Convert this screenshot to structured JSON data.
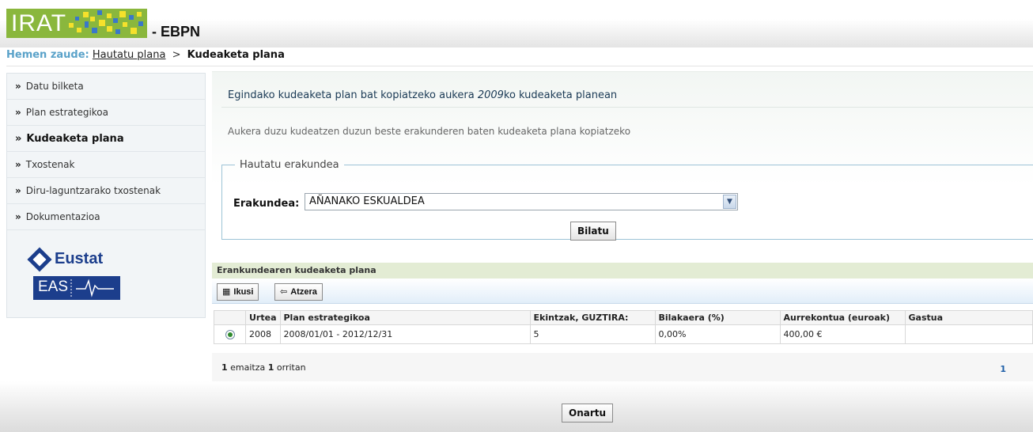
{
  "header": {
    "logo_text": "IRATI",
    "suffix": "- EBPN"
  },
  "breadcrumb": {
    "prefix": "Hemen zaude:",
    "link": "Hautatu plana",
    "separator": ">",
    "current": "Kudeaketa plana"
  },
  "sidebar": {
    "items": [
      {
        "label": "Datu bilketa",
        "active": false
      },
      {
        "label": "Plan estrategikoa",
        "active": false
      },
      {
        "label": "Kudeaketa plana",
        "active": true
      },
      {
        "label": "Txostenak",
        "active": false
      },
      {
        "label": "Diru-laguntzarako txostenak",
        "active": false
      },
      {
        "label": "Dokumentazioa",
        "active": false
      }
    ],
    "logo_eustat": "Eustat",
    "logo_eas": "EAS"
  },
  "intro": {
    "title_before": "Egindako kudeaketa plan bat kopiatzeko aukera ",
    "title_year": "2009",
    "title_after": "ko kudeaketa planean",
    "subtitle": "Aukera duzu kudeatzen duzun beste erakunderen baten kudeaketa plana kopiatzeko"
  },
  "form": {
    "legend": "Hautatu erakundea",
    "label": "Erakundea:",
    "selected": "AÑANAKO ESKUALDEA",
    "search_button": "Bilatu"
  },
  "results": {
    "title": "Erankundearen kudeaketa plana",
    "view_button": "Ikusi",
    "back_button": "Atzera",
    "columns": [
      "",
      "Urtea",
      "Plan estrategikoa",
      "Ekintzak, GUZTIRA:",
      "Bilakaera (%)",
      "Aurrekontua (euroak)",
      "Gastua"
    ],
    "rows": [
      {
        "year": "2008",
        "plan": "2008/01/01 - 2012/12/31",
        "actions": "5",
        "evolution": "0,00%",
        "budget": "400,00 €",
        "spent": ""
      }
    ],
    "pager_count": "1",
    "pager_results_word": "emaitza",
    "pager_pages": "1",
    "pager_pages_word": "orritan",
    "current_page": "1"
  },
  "footer": {
    "accept_button": "Onartu"
  },
  "colors": {
    "logo_green": "#8ab73d",
    "breadcrumb_prefix": "#5aa2c9",
    "eustat_blue": "#1c3e8c"
  }
}
